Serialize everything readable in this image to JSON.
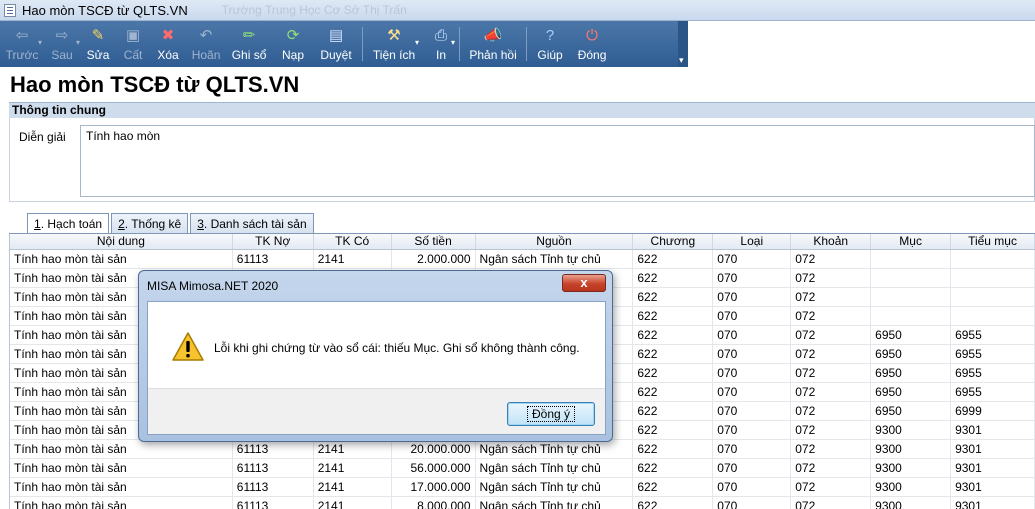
{
  "window": {
    "title": "Hao mòn TSCĐ từ QLTS.VN",
    "ghost_text": "Trường Trung Học Cơ Sở Thị Trấn"
  },
  "toolbar": {
    "buttons": [
      {
        "label": "Trước",
        "icon": "arrow-left-icon",
        "enabled": false
      },
      {
        "label": "Sau",
        "icon": "arrow-right-icon",
        "enabled": false
      },
      {
        "label": "Sửa",
        "icon": "edit-icon",
        "enabled": true
      },
      {
        "label": "Cất",
        "icon": "save-icon",
        "enabled": false
      },
      {
        "label": "Xóa",
        "icon": "delete-icon",
        "enabled": true
      },
      {
        "label": "Hoãn",
        "icon": "undo-icon",
        "enabled": false
      },
      {
        "label": "Ghi sổ",
        "icon": "pencil-icon",
        "enabled": true
      },
      {
        "label": "Nạp",
        "icon": "reload-icon",
        "enabled": true
      },
      {
        "label": "Duyệt",
        "icon": "approve-icon",
        "enabled": true
      },
      {
        "label": "Tiện ích",
        "icon": "tools-icon",
        "enabled": true
      },
      {
        "label": "In",
        "icon": "print-icon",
        "enabled": true
      },
      {
        "label": "Phản hồi",
        "icon": "megaphone-icon",
        "enabled": true
      },
      {
        "label": "Giúp",
        "icon": "help-icon",
        "enabled": true
      },
      {
        "label": "Đóng",
        "icon": "power-icon",
        "enabled": true
      }
    ]
  },
  "page_title": "Hao mòn TSCĐ từ QLTS.VN",
  "general": {
    "section_label": "Thông tin chung",
    "desc_label": "Diễn giải",
    "desc_value": "Tính hao mòn"
  },
  "tabs": [
    {
      "num": "1",
      "label": ". Hạch toán"
    },
    {
      "num": "2",
      "label": ". Thống kê"
    },
    {
      "num": "3",
      "label": ". Danh sách tài sản"
    }
  ],
  "grid": {
    "columns": [
      "Nội dung",
      "TK Nợ",
      "TK Có",
      "Số tiền",
      "Nguồn",
      "Chương",
      "Loại",
      "Khoản",
      "Mục",
      "Tiểu mục"
    ],
    "rows": [
      [
        "Tính hao mòn tài sản",
        "61113",
        "2141",
        "2.000.000",
        "Ngân sách Tỉnh tự chủ",
        "622",
        "070",
        "072",
        "",
        ""
      ],
      [
        "Tính hao mòn tài sản",
        "",
        "",
        "",
        "",
        "622",
        "070",
        "072",
        "",
        ""
      ],
      [
        "Tính hao mòn tài sản",
        "",
        "",
        "",
        "",
        "622",
        "070",
        "072",
        "",
        ""
      ],
      [
        "Tính hao mòn tài sản",
        "",
        "",
        "",
        "",
        "622",
        "070",
        "072",
        "",
        ""
      ],
      [
        "Tính hao mòn tài sản",
        "",
        "",
        "",
        "",
        "622",
        "070",
        "072",
        "6950",
        "6955"
      ],
      [
        "Tính hao mòn tài sản",
        "",
        "",
        "",
        "",
        "622",
        "070",
        "072",
        "6950",
        "6955"
      ],
      [
        "Tính hao mòn tài sản",
        "",
        "",
        "",
        "",
        "622",
        "070",
        "072",
        "6950",
        "6955"
      ],
      [
        "Tính hao mòn tài sản",
        "",
        "",
        "",
        "",
        "622",
        "070",
        "072",
        "6950",
        "6955"
      ],
      [
        "Tính hao mòn tài sản",
        "",
        "",
        "",
        "",
        "622",
        "070",
        "072",
        "6950",
        "6999"
      ],
      [
        "Tính hao mòn tài sản",
        "",
        "",
        "",
        "",
        "622",
        "070",
        "072",
        "9300",
        "9301"
      ],
      [
        "Tính hao mòn tài sản",
        "61113",
        "2141",
        "20.000.000",
        "Ngân sách Tỉnh tự chủ",
        "622",
        "070",
        "072",
        "9300",
        "9301"
      ],
      [
        "Tính hao mòn tài sản",
        "61113",
        "2141",
        "56.000.000",
        "Ngân sách Tỉnh tự chủ",
        "622",
        "070",
        "072",
        "9300",
        "9301"
      ],
      [
        "Tính hao mòn tài sản",
        "61113",
        "2141",
        "17.000.000",
        "Ngân sách Tỉnh tự chủ",
        "622",
        "070",
        "072",
        "9300",
        "9301"
      ],
      [
        "Tính hao mòn tài sản",
        "61113",
        "2141",
        "8.000.000",
        "Ngân sách Tỉnh tự chủ",
        "622",
        "070",
        "072",
        "9300",
        "9301"
      ]
    ]
  },
  "dialog": {
    "title": "MISA Mimosa.NET 2020",
    "message": "Lỗi khi ghi chứng từ vào sổ cái: thiếu Mục. Ghi sổ không thành công.",
    "ok_label": "Đồng ý",
    "close_glyph": "x"
  }
}
